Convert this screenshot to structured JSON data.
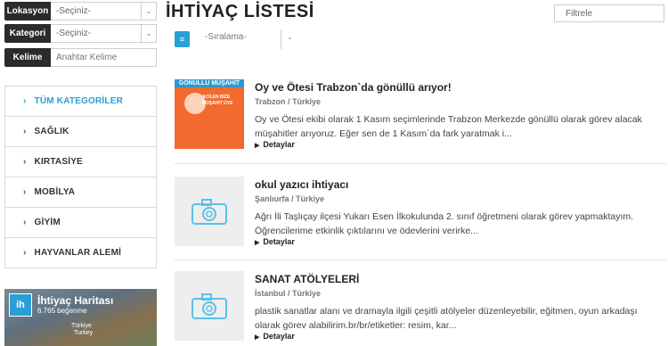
{
  "filters": {
    "location": {
      "label": "Lokasyon",
      "value": "-Seçiniz-"
    },
    "category": {
      "label": "Kategori",
      "value": "-Seçiniz-"
    },
    "keyword": {
      "label": "Kelime",
      "placeholder": "Anahtar Kelime"
    }
  },
  "categories": [
    {
      "label": "TÜM KATEGORİLER",
      "active": true
    },
    {
      "label": "SAĞLIK"
    },
    {
      "label": "KIRTASİYE"
    },
    {
      "label": "MOBİLYA"
    },
    {
      "label": "GİYİM"
    },
    {
      "label": "HAYVANLAR ALEMİ"
    }
  ],
  "facebook": {
    "logo": "ih",
    "title": "İhtiyaç Haritası",
    "likes": "6.765 beğenme",
    "map_label_1": "Türkiye",
    "map_label_2": "Turkey"
  },
  "main": {
    "title": "İHTİYAÇ LİSTESİ",
    "search_placeholder": "Filtrele",
    "sort_value": "-Sıralama-"
  },
  "items": [
    {
      "title": "Oy ve Ötesi Trabzon`da gönüllü arıyor!",
      "location": "Trabzon / Türkiye",
      "description": "Oy ve Ötesi ekibi olarak 1 Kasım seçimlerinde Trabzon Merkezde gönüllü olarak görev alacak müşahitler arıyoruz. Eğer sen de 1 Kasım`da fark yaratmak i...",
      "more": "Detaylar",
      "poster_band": "GÖNÜLLÜ MÜŞAHİT",
      "poster_text": "ACİLEN BİZE MÜŞAHİT ÜYE"
    },
    {
      "title": "okul yazıcı ihtiyacı",
      "location": "Şanlıurfa / Türkiye",
      "description": "Ağrı İli Taşlıçay ilçesi Yukarı Esen İlkokulunda 2. sınıf öğretmeni olarak görev yapmaktayım. Öğrencilerime etkinlik çıktılarını ve ödevlerini verirke...",
      "more": "Detaylar"
    },
    {
      "title": "SANAT ATÖLYELERİ",
      "location": "İstanbul / Türkiye",
      "description": "plastik sanatlar alanı ve dramayla ilgili çeşitli atölyeler düzenleyebilir, eğitmen, oyun arkadaşı olarak görev alabilirim.br/br/etiketler: resim, kar...",
      "more": "Detaylar"
    }
  ],
  "icons": {
    "dropdown": "chevron-down-icon",
    "category_bullet": "chevron-right-icon",
    "placeholder": "camera-icon"
  },
  "colors": {
    "accent": "#2a9fd6",
    "label_bg": "#2b2b2b",
    "poster": "#f26a2e"
  }
}
